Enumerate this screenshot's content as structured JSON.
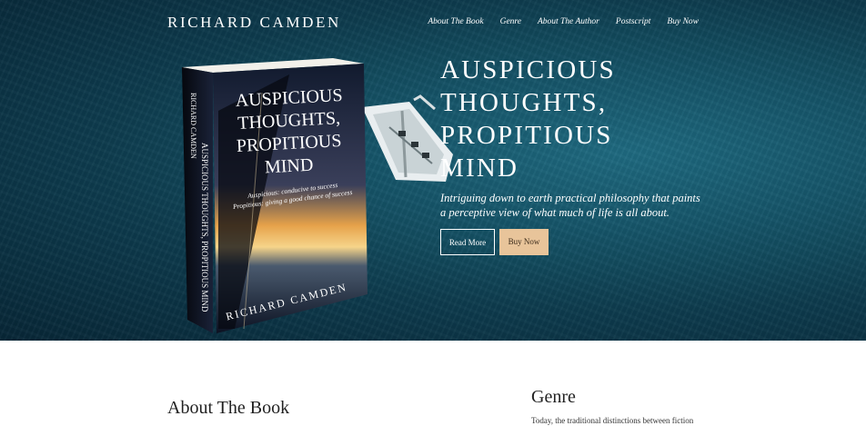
{
  "brand": {
    "name": "RICHARD CAMDEN"
  },
  "nav": {
    "items": [
      {
        "label": "About The Book"
      },
      {
        "label": "Genre"
      },
      {
        "label": "About The Author"
      },
      {
        "label": "Postscript"
      },
      {
        "label": "Buy Now"
      }
    ]
  },
  "hero": {
    "headline_lines": [
      "AUSPICIOUS",
      "THOUGHTS,",
      "PROPITIOUS",
      "MIND"
    ],
    "tagline_lines": [
      "Intriguing down to earth practical philosophy that paints",
      "a perceptive view of what much of life is all about."
    ],
    "read_more_label": "Read More",
    "buy_now_label": "Buy Now"
  },
  "book": {
    "cover_title_lines": [
      "AUSPICIOUS",
      "THOUGHTS,",
      "PROPITIOUS",
      "MIND"
    ],
    "cover_def_lines": [
      "Auspicious: conducive to success",
      "Propitious: giving a good chance of success"
    ],
    "cover_author": "RICHARD  CAMDEN",
    "spine_author": "RICHARD CAMDEN",
    "spine_title": "AUSPICIOUS THOUGHTS, PROPITIOUS MIND"
  },
  "about": {
    "heading": "About The Book"
  },
  "genre": {
    "heading": "Genre",
    "text": "Today, the traditional distinctions between fiction"
  },
  "colors": {
    "hero_bg": "#0d3b4d",
    "buy_button": "#e8c49a",
    "text_light": "#ffffff"
  }
}
